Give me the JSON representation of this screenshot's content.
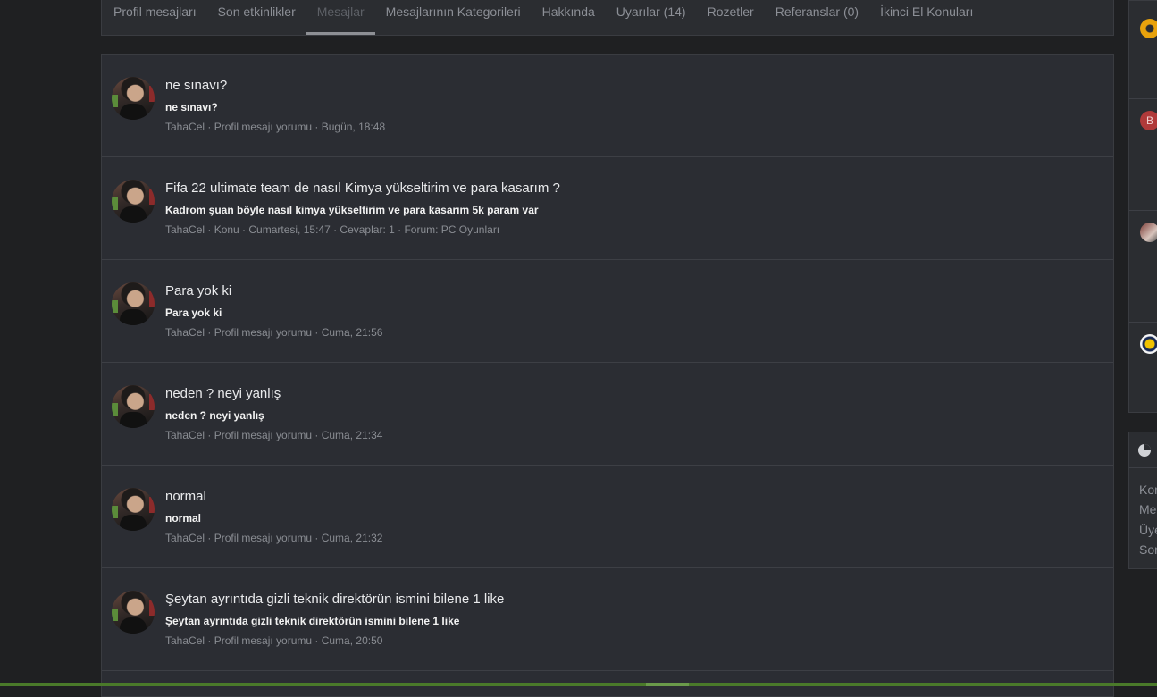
{
  "tabs": [
    {
      "label": "Profil mesajları",
      "active": false
    },
    {
      "label": "Son etkinlikler",
      "active": false
    },
    {
      "label": "Mesajlar",
      "active": true
    },
    {
      "label": "Mesajlarının Kategorileri",
      "active": false
    },
    {
      "label": "Hakkında",
      "active": false
    },
    {
      "label": "Uyarılar (14)",
      "active": false
    },
    {
      "label": "Rozetler",
      "active": false
    },
    {
      "label": "Referanslar (0)",
      "active": false
    },
    {
      "label": "İkinci El Konuları",
      "active": false
    }
  ],
  "messages": [
    {
      "title": "ne sınavı?",
      "snippet": "ne sınavı?",
      "meta": "TahaCel · Profil mesajı yorumu · Bugün, 18:48"
    },
    {
      "title": "Fifa 22 ultimate team de nasıl Kimya yükseltirim ve para kasarım ?",
      "snippet": "Kadrom şuan böyle nasıl kimya yükseltirim ve para kasarım 5k param var",
      "meta": "TahaCel · Konu · Cumartesi, 15:47 · Cevaplar: 1 · Forum: PC Oyunları"
    },
    {
      "title": "Para yok ki",
      "snippet": "Para yok ki",
      "meta": "TahaCel · Profil mesajı yorumu · Cuma, 21:56"
    },
    {
      "title": "neden ? neyi yanlış",
      "snippet": "neden ? neyi yanlış",
      "meta": "TahaCel · Profil mesajı yorumu · Cuma, 21:34"
    },
    {
      "title": "normal",
      "snippet": "normal",
      "meta": "TahaCel · Profil mesajı yorumu · Cuma, 21:32"
    },
    {
      "title": "Şeytan ayrıntıda gizli teknik direktörün ismini bilene 1 like",
      "snippet": "Şeytan ayrıntıda gizli teknik direktörün ismini bilene 1 like",
      "meta": "TahaCel · Profil mesajı yorumu · Cuma, 20:50"
    }
  ],
  "sidebar": {
    "avatar_letter": "B",
    "stats": [
      "Kon",
      "Me",
      "Üye",
      "Son"
    ]
  },
  "colors": {
    "accent_green": "#4a7a2a",
    "avatar_b": "#b03a3a"
  }
}
